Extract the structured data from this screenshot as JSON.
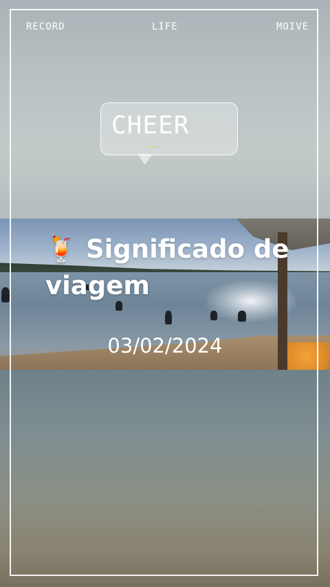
{
  "nav": {
    "record": "RECORD",
    "life": "LIFE",
    "moive": "MOIVE"
  },
  "bubble": {
    "text": "CHEER",
    "subtext": "ᴗᴗᴗ"
  },
  "title": {
    "emoji": "🍹",
    "line1": "Significado de",
    "line2": "viagem"
  },
  "date": "03/02/2024",
  "colors": {
    "frame": "#ffffff",
    "text": "#ffffff",
    "accent": "#e5c54a"
  }
}
